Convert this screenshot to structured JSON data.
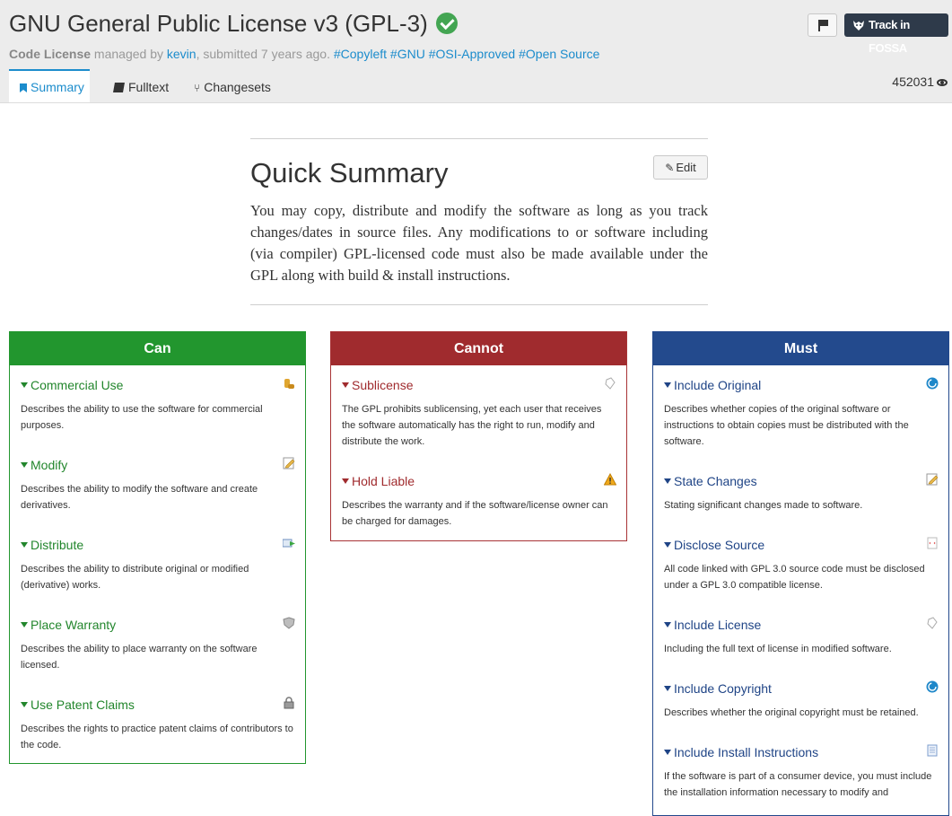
{
  "header": {
    "title": "GNU General Public License v3 (GPL-3)",
    "fossa_label": "Track in FOSSA",
    "meta": {
      "type": "Code License",
      "managed_by": "managed by",
      "user": "kevin",
      "submitted": ", submitted 7 years ago.",
      "tags": [
        "#Copyleft",
        "#GNU",
        "#OSI-Approved",
        "#Open Source"
      ]
    },
    "tabs": [
      "Summary",
      "Fulltext",
      "Changesets"
    ],
    "views": "452031"
  },
  "summary": {
    "title": "Quick Summary",
    "edit_label": "Edit",
    "text": "You may copy, distribute and modify the software as long as you track changes/dates in source files. Any modifications to or software including (via compiler) GPL-licensed code must also be made available under the GPL along with build & install instructions."
  },
  "columns": {
    "can": {
      "heading": "Can",
      "items": [
        {
          "label": "Commercial Use",
          "desc": "Describes the ability to use the software for commercial purposes.",
          "icon": "coins-icon"
        },
        {
          "label": "Modify",
          "desc": "Describes the ability to modify the software and create derivatives.",
          "icon": "edit-document-icon"
        },
        {
          "label": "Distribute",
          "desc": "Describes the ability to distribute original or modified (derivative) works.",
          "icon": "send-mail-icon"
        },
        {
          "label": "Place Warranty",
          "desc": "Describes the ability to place warranty on the software licensed.",
          "icon": "shield-icon"
        },
        {
          "label": "Use Patent Claims",
          "desc": "Describes the rights to practice patent claims of contributors to the code.",
          "icon": "lock-icon"
        }
      ]
    },
    "cannot": {
      "heading": "Cannot",
      "items": [
        {
          "label": "Sublicense",
          "desc": "The GPL prohibits sublicensing, yet each user that receives the software automatically has the right to run, modify and distribute the work.",
          "icon": "tag-icon"
        },
        {
          "label": "Hold Liable",
          "desc": "Describes the warranty and if the software/license owner can be charged for damages.",
          "icon": "warning-icon"
        }
      ]
    },
    "must": {
      "heading": "Must",
      "items": [
        {
          "label": "Include Original",
          "desc": "Describes whether copies of the original software or instructions to obtain copies must be distributed with the software.",
          "icon": "copyright-icon"
        },
        {
          "label": "State Changes",
          "desc": "Stating significant changes made to software.",
          "icon": "edit-document-icon"
        },
        {
          "label": "Disclose Source",
          "desc": "All code linked with GPL 3.0 source code must be disclosed under a GPL 3.0 compatible license.",
          "icon": "source-file-icon"
        },
        {
          "label": "Include License",
          "desc": "Including the full text of license in modified software.",
          "icon": "tag-icon"
        },
        {
          "label": "Include Copyright",
          "desc": "Describes whether the original copyright must be retained.",
          "icon": "copyright-icon"
        },
        {
          "label": "Include Install Instructions",
          "desc": "If the software is part of a consumer device, you must include the installation information necessary to modify and",
          "icon": "document-icon"
        }
      ]
    }
  }
}
